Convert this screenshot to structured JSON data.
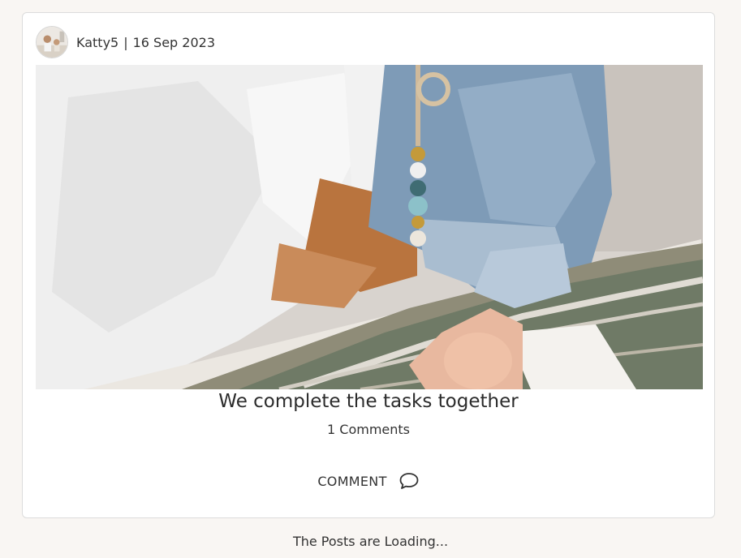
{
  "post": {
    "author": "Katty5",
    "separator": "|",
    "date": "16 Sep 2023",
    "title": "We complete the tasks together",
    "comments_count": "1 Comments",
    "comment_button_label": "COMMENT",
    "image_description": "Baby hand on open picture book",
    "avatar_icon": "user-avatar-icon",
    "comment_icon": "speech-bubble-icon"
  },
  "footer": {
    "loading_text": "The Posts are Loading..."
  },
  "colors": {
    "background": "#f9f6f3",
    "card": "#ffffff",
    "border": "#dcdcdc",
    "text": "#333333"
  }
}
